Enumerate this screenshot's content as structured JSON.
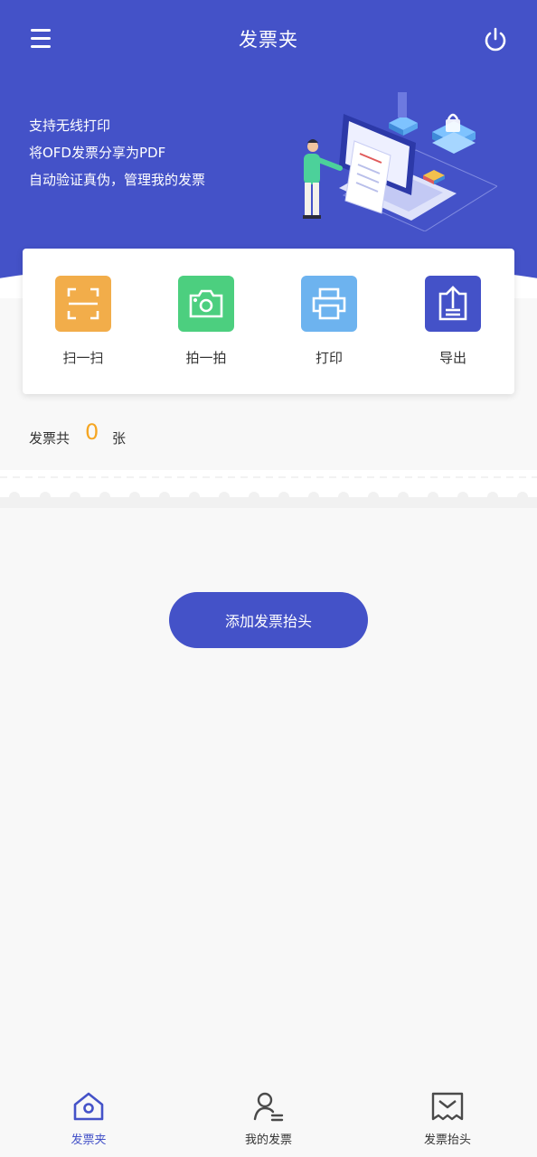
{
  "header": {
    "title": "发票夹"
  },
  "hero": {
    "lines": [
      "支持无线打印",
      "将OFD发票分享为PDF",
      "自动验证真伪，管理我的发票"
    ]
  },
  "actions": [
    {
      "label": "扫一扫",
      "icon": "scan-icon",
      "color": "#f2ad4a"
    },
    {
      "label": "拍一拍",
      "icon": "camera-icon",
      "color": "#4ccf7f"
    },
    {
      "label": "打印",
      "icon": "printer-icon",
      "color": "#6db3ef"
    },
    {
      "label": "导出",
      "icon": "export-icon",
      "color": "#4452c8"
    }
  ],
  "summary": {
    "prefix": "发票共",
    "count": "0",
    "suffix": "张"
  },
  "add_button": {
    "label": "添加发票抬头"
  },
  "tabbar": {
    "items": [
      {
        "label": "发票夹",
        "icon": "home-icon",
        "active": true
      },
      {
        "label": "我的发票",
        "icon": "user-icon",
        "active": false
      },
      {
        "label": "发票抬头",
        "icon": "receipt-icon",
        "active": false
      }
    ]
  },
  "colors": {
    "brand": "#4452c8",
    "count": "#f5a623"
  }
}
